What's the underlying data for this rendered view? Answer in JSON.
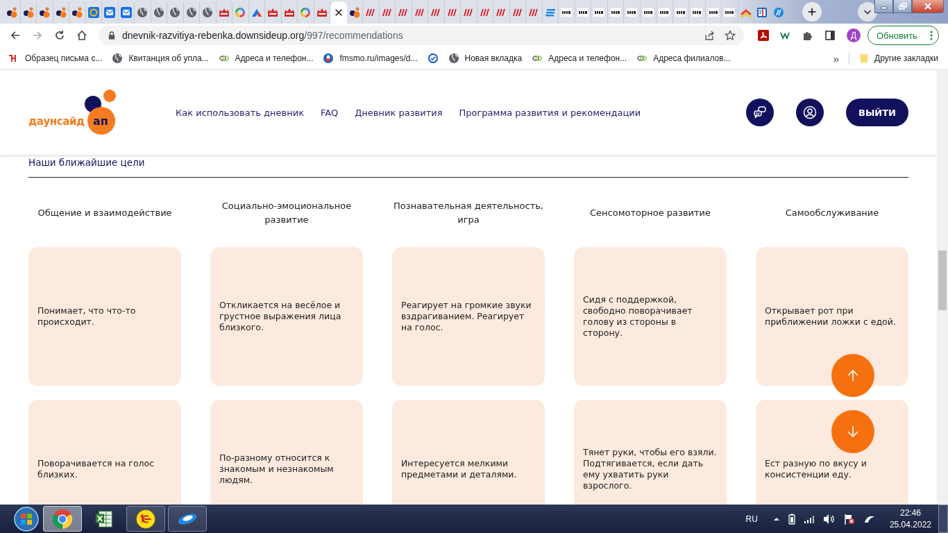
{
  "browser": {
    "tabs": [
      {
        "kind": "dsu",
        "selected": false
      },
      {
        "kind": "dsu",
        "selected": false
      },
      {
        "kind": "dsu",
        "selected": false
      },
      {
        "kind": "dsu",
        "selected": false
      },
      {
        "kind": "dsu",
        "selected": false
      },
      {
        "kind": "atmail",
        "selected": false
      },
      {
        "kind": "mail",
        "selected": false
      },
      {
        "kind": "mail",
        "selected": false
      },
      {
        "kind": "globe",
        "selected": false
      },
      {
        "kind": "globe",
        "selected": false
      },
      {
        "kind": "globe",
        "selected": false
      },
      {
        "kind": "globe",
        "selected": false
      },
      {
        "kind": "globe",
        "selected": false
      },
      {
        "kind": "castle",
        "selected": false
      },
      {
        "kind": "google",
        "selected": false
      },
      {
        "kind": "triangle",
        "selected": false
      },
      {
        "kind": "castle",
        "selected": false
      },
      {
        "kind": "castle",
        "selected": false
      },
      {
        "kind": "google",
        "selected": false
      },
      {
        "kind": "castle",
        "selected": false
      },
      {
        "kind": "none",
        "selected": true
      },
      {
        "kind": "dsu",
        "selected": false
      },
      {
        "kind": "hm",
        "selected": false
      },
      {
        "kind": "hm",
        "selected": false
      },
      {
        "kind": "hm",
        "selected": false
      },
      {
        "kind": "hm",
        "selected": false
      },
      {
        "kind": "hm",
        "selected": false
      },
      {
        "kind": "hm",
        "selected": false
      },
      {
        "kind": "hm",
        "selected": false
      },
      {
        "kind": "hm",
        "selected": false
      },
      {
        "kind": "hm",
        "selected": false
      },
      {
        "kind": "hm",
        "selected": false
      },
      {
        "kind": "hm",
        "selected": false
      },
      {
        "kind": "lines",
        "selected": false
      },
      {
        "kind": "zara",
        "selected": false
      },
      {
        "kind": "zara",
        "selected": false
      },
      {
        "kind": "zara",
        "selected": false
      },
      {
        "kind": "zara",
        "selected": false
      },
      {
        "kind": "zara",
        "selected": false
      },
      {
        "kind": "zara",
        "selected": false
      },
      {
        "kind": "zara",
        "selected": false
      },
      {
        "kind": "zara",
        "selected": false
      },
      {
        "kind": "zara",
        "selected": false
      },
      {
        "kind": "zara",
        "selected": false
      },
      {
        "kind": "zara",
        "selected": false
      },
      {
        "kind": "chevron",
        "selected": false
      },
      {
        "kind": "news",
        "selected": false
      },
      {
        "kind": "ball",
        "selected": false
      }
    ],
    "url": {
      "host": "dnevnik-razvitiya-rebenka.downsideup.org",
      "path": "/997/recommendations"
    },
    "profile_initial": "Д",
    "update_button": "Обновить",
    "bookmarks": [
      {
        "kind": "figure",
        "label": "Образец письма с..."
      },
      {
        "kind": "globe",
        "label": "Квитанция об упла..."
      },
      {
        "kind": "link",
        "label": "Адреса и телефон..."
      },
      {
        "kind": "emblem",
        "label": "fmsmo.ru/images/d..."
      },
      {
        "kind": "check"
      },
      {
        "kind": "globe",
        "label": "Новая вкладка"
      },
      {
        "kind": "link",
        "label": "Адреса и телефон..."
      },
      {
        "kind": "link",
        "label": "Адреса филиалов..."
      }
    ],
    "more": "»",
    "other_bookmarks": "Другие закладки"
  },
  "site": {
    "logo": {
      "word": "даунсайд",
      "badge": "ап"
    },
    "nav": [
      "Как использовать дневник",
      "FAQ",
      "Дневник развития",
      "Программа развития и рекомендации"
    ],
    "logout": "ВЫЙТИ",
    "section_title": "Наши ближайшие цели",
    "columns": [
      {
        "heading": "Общение и взаимодействие",
        "goals": [
          "Понимает, что что-то происходит.",
          "Поворачивается на голос близких."
        ]
      },
      {
        "heading": "Социально-эмоциональное развитие",
        "goals": [
          "Откликается на весёлое и грустное выражения лица близкого.",
          "По-разному относится к знакомым и незнакомым людям."
        ]
      },
      {
        "heading": "Познавательная деятельность, игра",
        "goals": [
          "Реагирует на громкие звуки вздрагиванием. Реагирует на голос.",
          "Интересуется мелкими предметами и деталями."
        ]
      },
      {
        "heading": "Сенсомоторное развитие",
        "goals": [
          "Сидя с поддержкой, свободно поворачивает голову из стороны в сторону.",
          "Тянет руки, чтобы его взяли. Подтягивается, если дать ему ухватить руки взрослого."
        ]
      },
      {
        "heading": "Самообслуживание",
        "goals": [
          "Открывает рот при приближении ложки с едой.",
          "Ест разную по вкусу и консистенции еду."
        ]
      }
    ]
  },
  "taskbar": {
    "apps": [
      {
        "kind": "chrome",
        "running": true,
        "selected": true
      },
      {
        "kind": "excel",
        "running": false,
        "selected": false
      },
      {
        "kind": "onec",
        "running": true,
        "selected": false
      },
      {
        "kind": "saucer",
        "running": true,
        "selected": false
      }
    ],
    "language": "RU",
    "time": "22:46",
    "date": "25.04.2022"
  }
}
